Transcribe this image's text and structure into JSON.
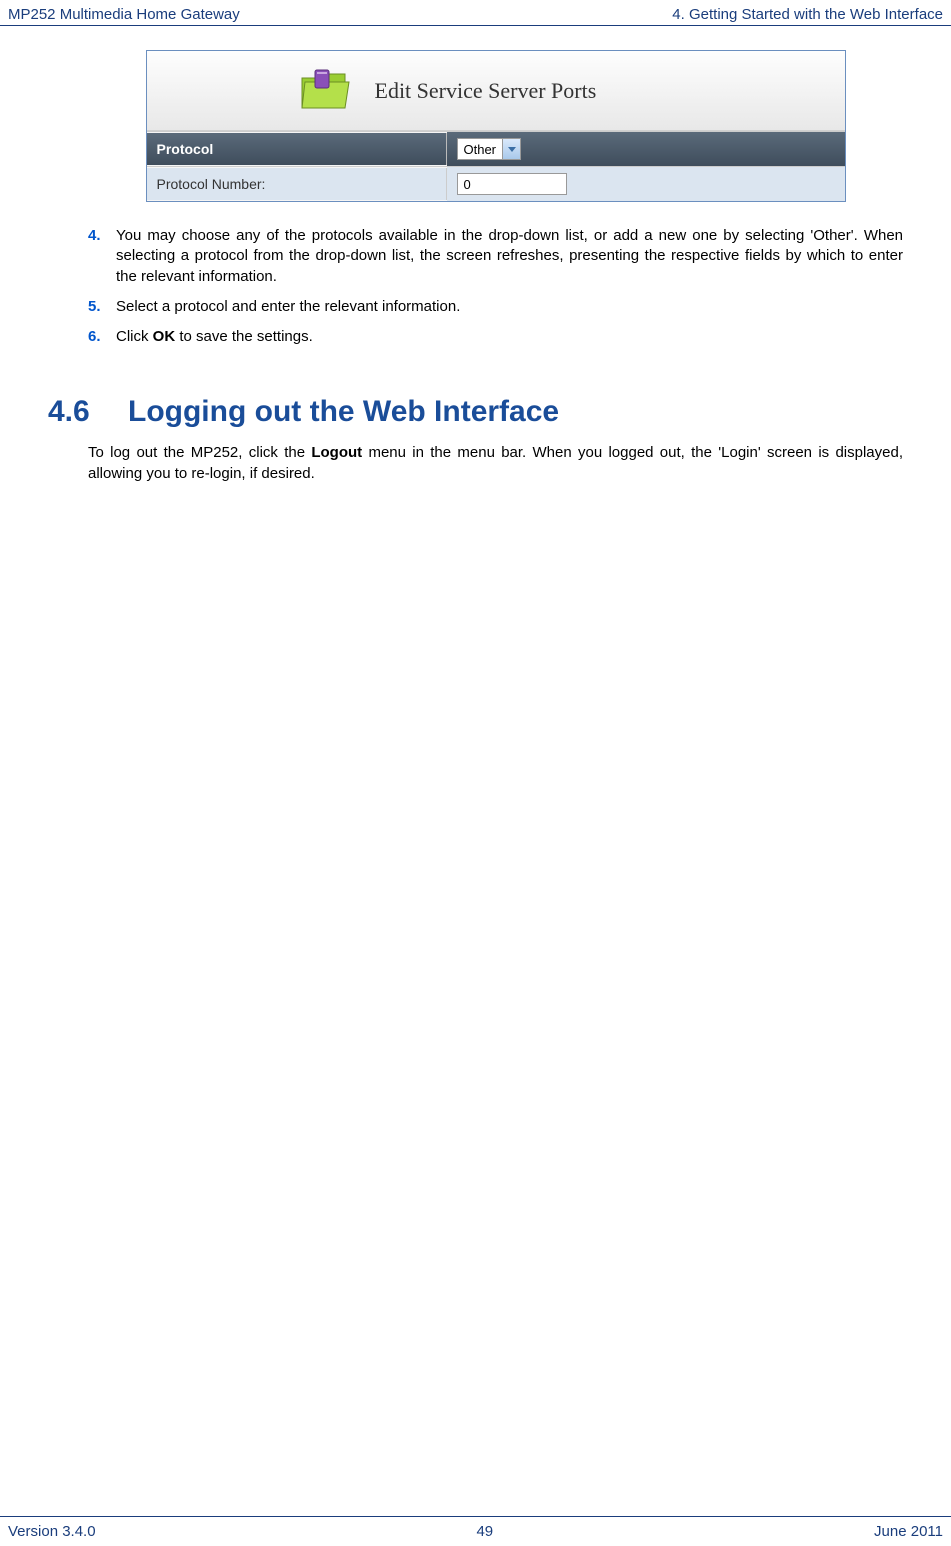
{
  "header": {
    "left": "MP252 Multimedia Home Gateway",
    "right": "4. Getting Started with the Web Interface"
  },
  "figure": {
    "title": "Edit Service Server Ports",
    "rows": [
      {
        "label": "Protocol",
        "type": "select",
        "value": "Other",
        "darkRow": true
      },
      {
        "label": "Protocol Number:",
        "type": "input",
        "value": "0",
        "darkRow": false
      }
    ]
  },
  "steps": [
    {
      "number": "4.",
      "text_before": "You may choose any of the protocols available in the drop-down list, or add a new one by selecting 'Other'. When selecting a protocol from the drop-down list, the screen refreshes, presenting the respective fields by which to enter the relevant information.",
      "bold": "",
      "text_after": ""
    },
    {
      "number": "5.",
      "text_before": "Select a protocol and enter the relevant information.",
      "bold": "",
      "text_after": ""
    },
    {
      "number": "6.",
      "text_before": "Click ",
      "bold": "OK",
      "text_after": " to save the settings."
    }
  ],
  "section": {
    "number": "4.6",
    "title": "Logging out the Web Interface",
    "body_before": "To log out the MP252, click the ",
    "body_bold": "Logout",
    "body_after": " menu in the menu bar. When you logged out, the 'Login' screen is displayed, allowing you to re-login, if desired."
  },
  "footer": {
    "left": "Version 3.4.0",
    "center": "49",
    "right": "June 2011"
  }
}
